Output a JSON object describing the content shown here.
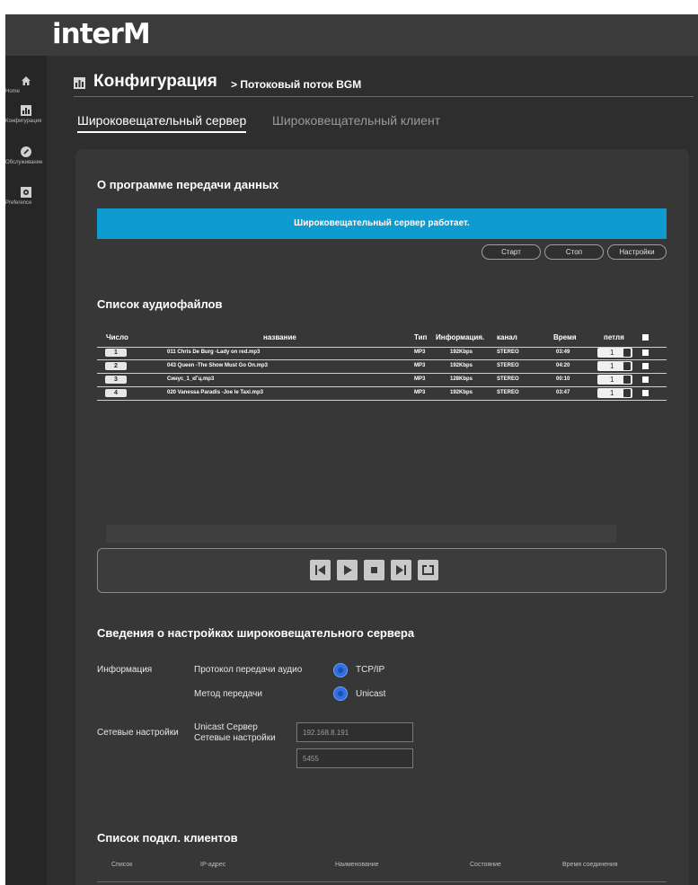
{
  "app": {
    "logo_text": "interM"
  },
  "sidebar": {
    "items": [
      {
        "label": "Home",
        "icon": "home-icon"
      },
      {
        "label": "Конфигурация",
        "icon": "chart-icon"
      },
      {
        "label": "Обслуживание",
        "icon": "wrench-icon"
      },
      {
        "label": "Preference",
        "icon": "gear-icon"
      }
    ]
  },
  "breadcrumb": {
    "title": "Конфигурация",
    "sub": "> Потоковый поток BGM"
  },
  "tabs": [
    {
      "label": "Широковещательный сервер",
      "active": true
    },
    {
      "label": "Широковещательный клиент",
      "active": false
    }
  ],
  "about": {
    "heading": "О программе передачи данных",
    "status": "Широковещательный сервер работает.",
    "status_color": "#0e9bcf",
    "buttons": {
      "start": "Старт",
      "stop": "Стоп",
      "settings": "Настройки"
    }
  },
  "audio_list": {
    "heading": "Список аудиофайлов",
    "columns": {
      "num": "Число",
      "name": "название",
      "type": "Тип",
      "info": "Информация.",
      "channel": "канал",
      "time": "Время",
      "loop": "петля"
    },
    "rows": [
      {
        "num": "1",
        "name": "011 Chris De Burg -Lady on red.mp3",
        "type": "MP3",
        "info": "192Kbps",
        "channel": "STEREO",
        "time": "03:49",
        "loop": "1"
      },
      {
        "num": "2",
        "name": "043 Queen -The Show Must Go On.mp3",
        "type": "MP3",
        "info": "192Kbps",
        "channel": "STEREO",
        "time": "04:20",
        "loop": "1"
      },
      {
        "num": "3",
        "name": "Синус_1_кГц.mp3",
        "type": "MP3",
        "info": "128Kbps",
        "channel": "STEREO",
        "time": "00:10",
        "loop": "1"
      },
      {
        "num": "4",
        "name": "020 Vanessa Paradis -Joe le Taxi.mp3",
        "type": "MP3",
        "info": "192Kbps",
        "channel": "STEREO",
        "time": "03:47",
        "loop": "1"
      }
    ]
  },
  "player": {
    "controls": [
      "previous-icon",
      "play-icon",
      "stop-icon",
      "next-icon",
      "repeat-icon"
    ]
  },
  "server_info": {
    "heading": "Сведения о настройках широковещательного сервера",
    "info_label": "Информация",
    "protocol_label": "Протокол передачи аудио",
    "protocol_value": "TCP/IP",
    "method_label": "Метод передачи",
    "method_value": "Unicast",
    "network_label": "Сетевые настройки",
    "unicast_server_label": "Unicast Сервер",
    "unicast_net_label": "Сетевые настройки",
    "ip_value": "192.168.8.191",
    "port_value": "5455"
  },
  "clients": {
    "heading": "Список подкл. клиентов",
    "columns": {
      "list": "Список",
      "ip": "IP-адрес",
      "name": "Наименование",
      "state": "Состояние",
      "conn_time": "Время соединения"
    }
  }
}
